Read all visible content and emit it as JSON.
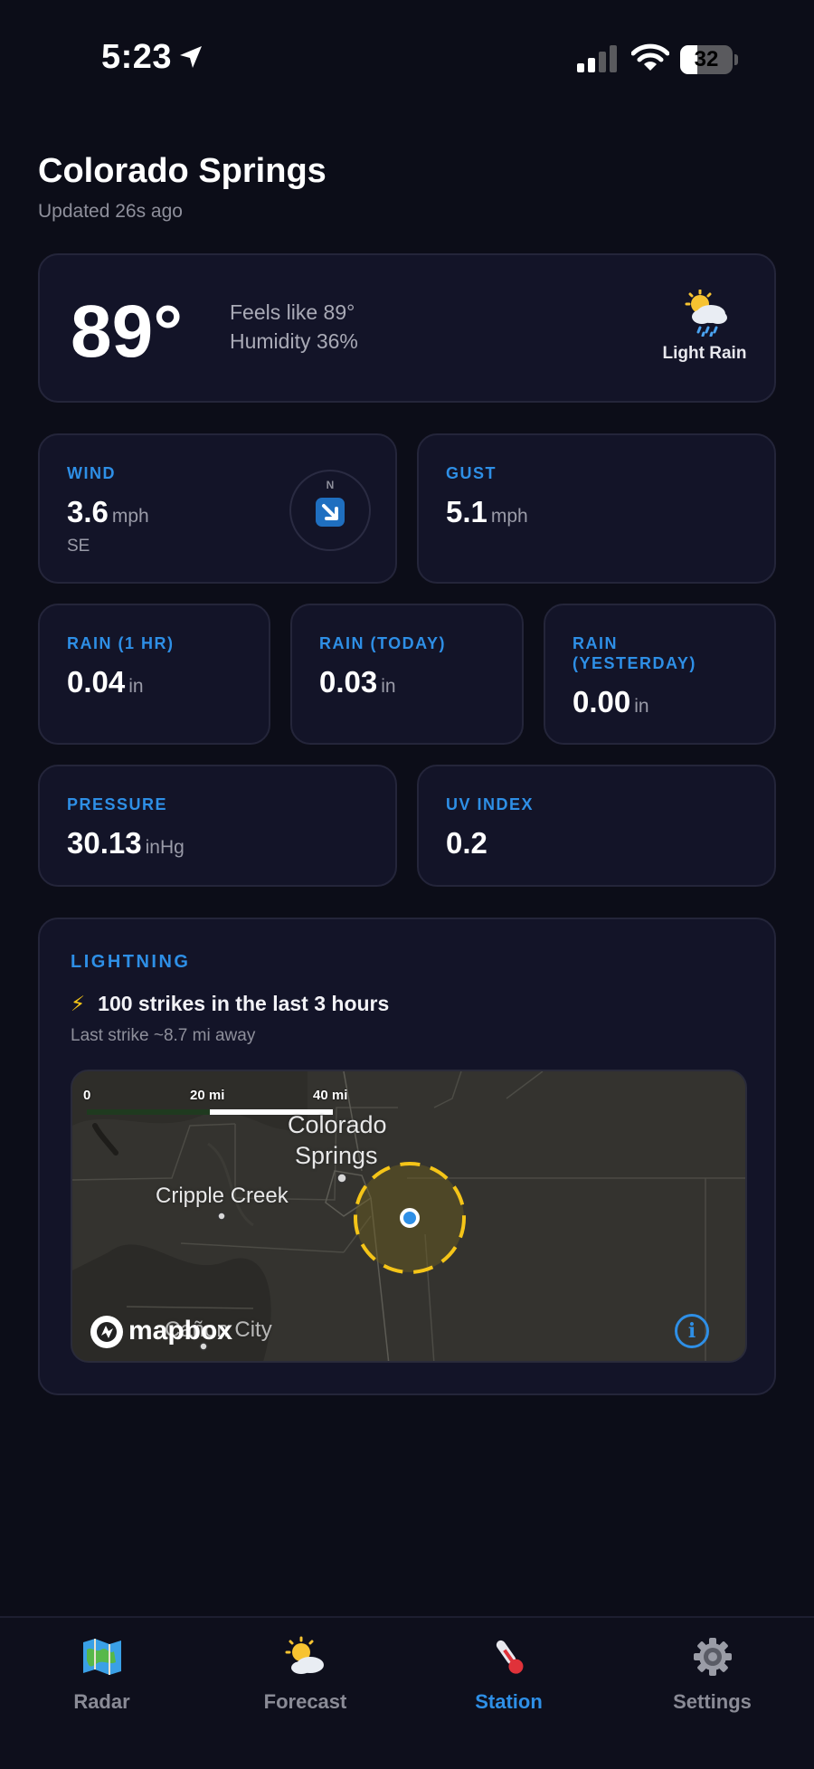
{
  "status_bar": {
    "time": "5:23",
    "battery": "32",
    "battery_level": 0.32
  },
  "header": {
    "city": "Colorado Springs",
    "updated": "Updated 26s ago"
  },
  "current": {
    "temp": "89°",
    "feels_like": "Feels like 89°",
    "humidity": "Humidity 36%",
    "condition": "Light Rain",
    "condition_icon": "cloud-sun-rain-icon"
  },
  "wind": {
    "label": "WIND",
    "value": "3.6",
    "unit": "mph",
    "direction": "SE",
    "compass_n": "N"
  },
  "gust": {
    "label": "GUST",
    "value": "5.1",
    "unit": "mph"
  },
  "rain_1hr": {
    "label": "RAIN (1 HR)",
    "value": "0.04",
    "unit": "in"
  },
  "rain_today": {
    "label": "RAIN (TODAY)",
    "value": "0.03",
    "unit": "in"
  },
  "rain_yesterday": {
    "label_line1": "RAIN",
    "label_line2": "(YESTERDAY)",
    "value": "0.00",
    "unit": "in"
  },
  "pressure": {
    "label": "PRESSURE",
    "value": "30.13",
    "unit": "inHg"
  },
  "uv": {
    "label": "UV INDEX",
    "value": "0.2"
  },
  "lightning": {
    "label": "LIGHTNING",
    "summary": "100 strikes in the last 3 hours",
    "last_strike": "Last strike ~8.7 mi away",
    "map": {
      "scale_0": "0",
      "scale_20": "20 mi",
      "scale_40": "40 mi",
      "city_line1": "Colorado",
      "city_line2": "Springs",
      "town1": "Cripple Creek",
      "town2": "Cañon City",
      "attribution": "mapbox",
      "info": "i"
    }
  },
  "tabs": [
    {
      "label": "Radar",
      "icon": "map-icon"
    },
    {
      "label": "Forecast",
      "icon": "sun-cloud-icon"
    },
    {
      "label": "Station",
      "icon": "thermometer-icon",
      "active": true
    },
    {
      "label": "Settings",
      "icon": "gear-icon"
    }
  ],
  "colors": {
    "accent": "#2e8fe6",
    "background": "#0c0d18",
    "card": "#131428",
    "strike_ring": "#f5c518"
  }
}
